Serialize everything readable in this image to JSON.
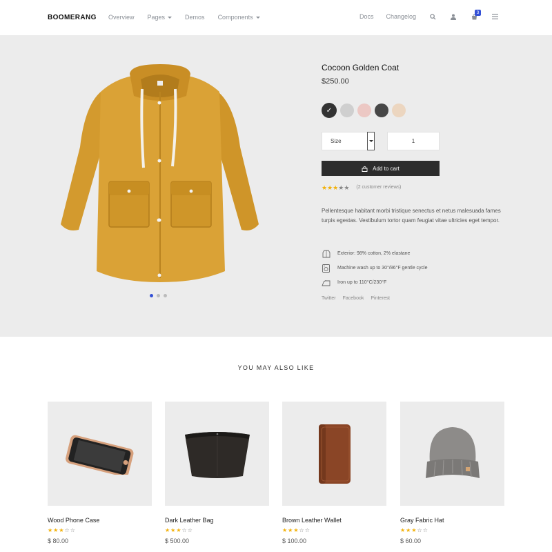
{
  "nav": {
    "brand": "BOOMERANG",
    "left_links": [
      "Overview",
      "Pages",
      "Demos",
      "Components"
    ],
    "right_links": [
      "Docs",
      "Changelog"
    ],
    "icons": [
      "search-icon",
      "user-icon",
      "cart-icon",
      "menu-icon"
    ],
    "cart_count": "3"
  },
  "product": {
    "title": "Cocoon Golden Coat",
    "price": "$250.00",
    "swatch_colors": [
      "#333333",
      "#cfcfcf",
      "#ecc8c4",
      "#474747",
      "#ecd6c0"
    ],
    "selected_swatch": 0,
    "size_label": "Size",
    "quantity": "1",
    "add_to_cart": "Add to cart",
    "rating": 3,
    "rating_max": 5,
    "reviews": "(2 customer reviews)",
    "description": "Pellentesque habitant morbi tristique senectus et netus malesuada fames turpis egestas. Vestibulum tortor quam feugiat vitae ultricies eget tempor.",
    "specs": [
      {
        "icon": "shirt-icon",
        "text": "Exterior: 98% cotton, 2% elastane"
      },
      {
        "icon": "washing-machine-icon",
        "text": "Machine wash up to 30°/86°F gentle cycle"
      },
      {
        "icon": "iron-icon",
        "text": "Iron up to 110°C/230°F"
      }
    ],
    "share": [
      "Twitter",
      "Facebook",
      "Pinterest"
    ],
    "gallery_slides": 3,
    "gallery_active": 0
  },
  "related": {
    "title": "YOU MAY ALSO LIKE",
    "items": [
      {
        "name": "Wood Phone Case",
        "price": "$ 80.00",
        "rating": 3
      },
      {
        "name": "Dark Leather Bag",
        "price": "$ 500.00",
        "rating": 3
      },
      {
        "name": "Brown Leather Wallet",
        "price": "$ 100.00",
        "rating": 3
      },
      {
        "name": "Gray Fabric Hat",
        "price": "$ 60.00",
        "rating": 3
      }
    ]
  }
}
